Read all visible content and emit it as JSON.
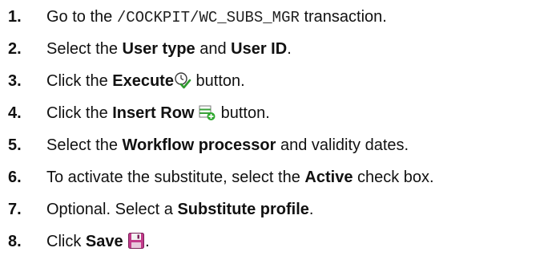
{
  "steps": [
    {
      "number": "1.",
      "pre": "Go to the ",
      "code": "/COCKPIT/WC_SUBS_MGR",
      "post": " transaction."
    },
    {
      "number": "2.",
      "pre": "Select the ",
      "bold1": "User type",
      "mid": " and ",
      "bold2": "User ID",
      "post": "."
    },
    {
      "number": "3.",
      "pre": "Click the ",
      "bold": "Execute",
      "icon": "execute-clock-check-icon",
      "post": " button."
    },
    {
      "number": "4.",
      "pre": "Click the ",
      "bold": "Insert Row",
      "icon": "insert-row-icon",
      "post": " button."
    },
    {
      "number": "5.",
      "pre": "Select the ",
      "bold": "Workflow processor",
      "post": " and validity dates."
    },
    {
      "number": "6.",
      "pre": "To activate the substitute, select the ",
      "bold": "Active",
      "post": " check box."
    },
    {
      "number": "7.",
      "pre": "Optional. Select a ",
      "bold": "Substitute profile",
      "post": "."
    },
    {
      "number": "8.",
      "pre": "Click ",
      "bold": "Save",
      "icon": "save-floppy-icon",
      "post": "."
    }
  ]
}
